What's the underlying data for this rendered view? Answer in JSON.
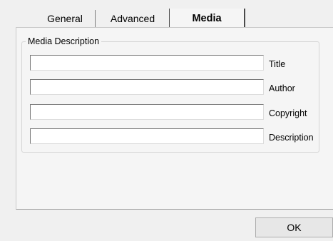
{
  "tabs": {
    "general": "General",
    "advanced": "Advanced",
    "media": "Media"
  },
  "group": {
    "legend": "Media Description",
    "fields": [
      {
        "label": "Title",
        "value": ""
      },
      {
        "label": "Author",
        "value": ""
      },
      {
        "label": "Copyright",
        "value": ""
      },
      {
        "label": "Description",
        "value": ""
      }
    ]
  },
  "buttons": {
    "ok": "OK"
  },
  "selected_tab": "Media"
}
